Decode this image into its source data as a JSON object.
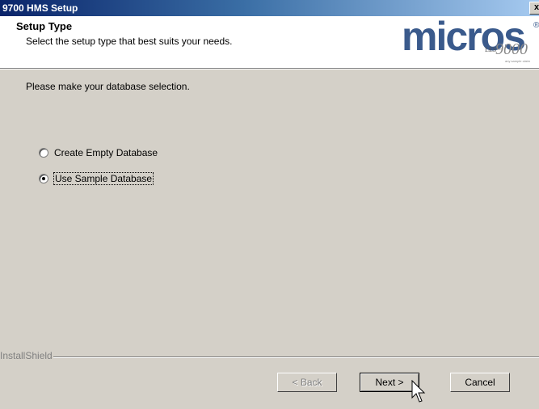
{
  "window": {
    "title": "9700 HMS Setup",
    "close_label": "x"
  },
  "header": {
    "title": "Setup Type",
    "subtitle": "Select the setup type that best suits your needs.",
    "logo": {
      "brand": "micros",
      "registered": "®",
      "les": "LES",
      "version": "9000",
      "tagline": "any sample claim"
    }
  },
  "main": {
    "prompt": "Please make your database selection.",
    "options": [
      {
        "label": "Create Empty Database",
        "checked": false
      },
      {
        "label": "Use Sample Database",
        "checked": true
      }
    ]
  },
  "footer": {
    "installshield_label": "InstallShield",
    "back_label": "< Back",
    "next_label": "Next >",
    "cancel_label": "Cancel"
  },
  "colors": {
    "titlebar_start": "#0a246a",
    "titlebar_end": "#a6caf0",
    "face": "#d4d0c8",
    "logo": "#3a5a8c"
  }
}
